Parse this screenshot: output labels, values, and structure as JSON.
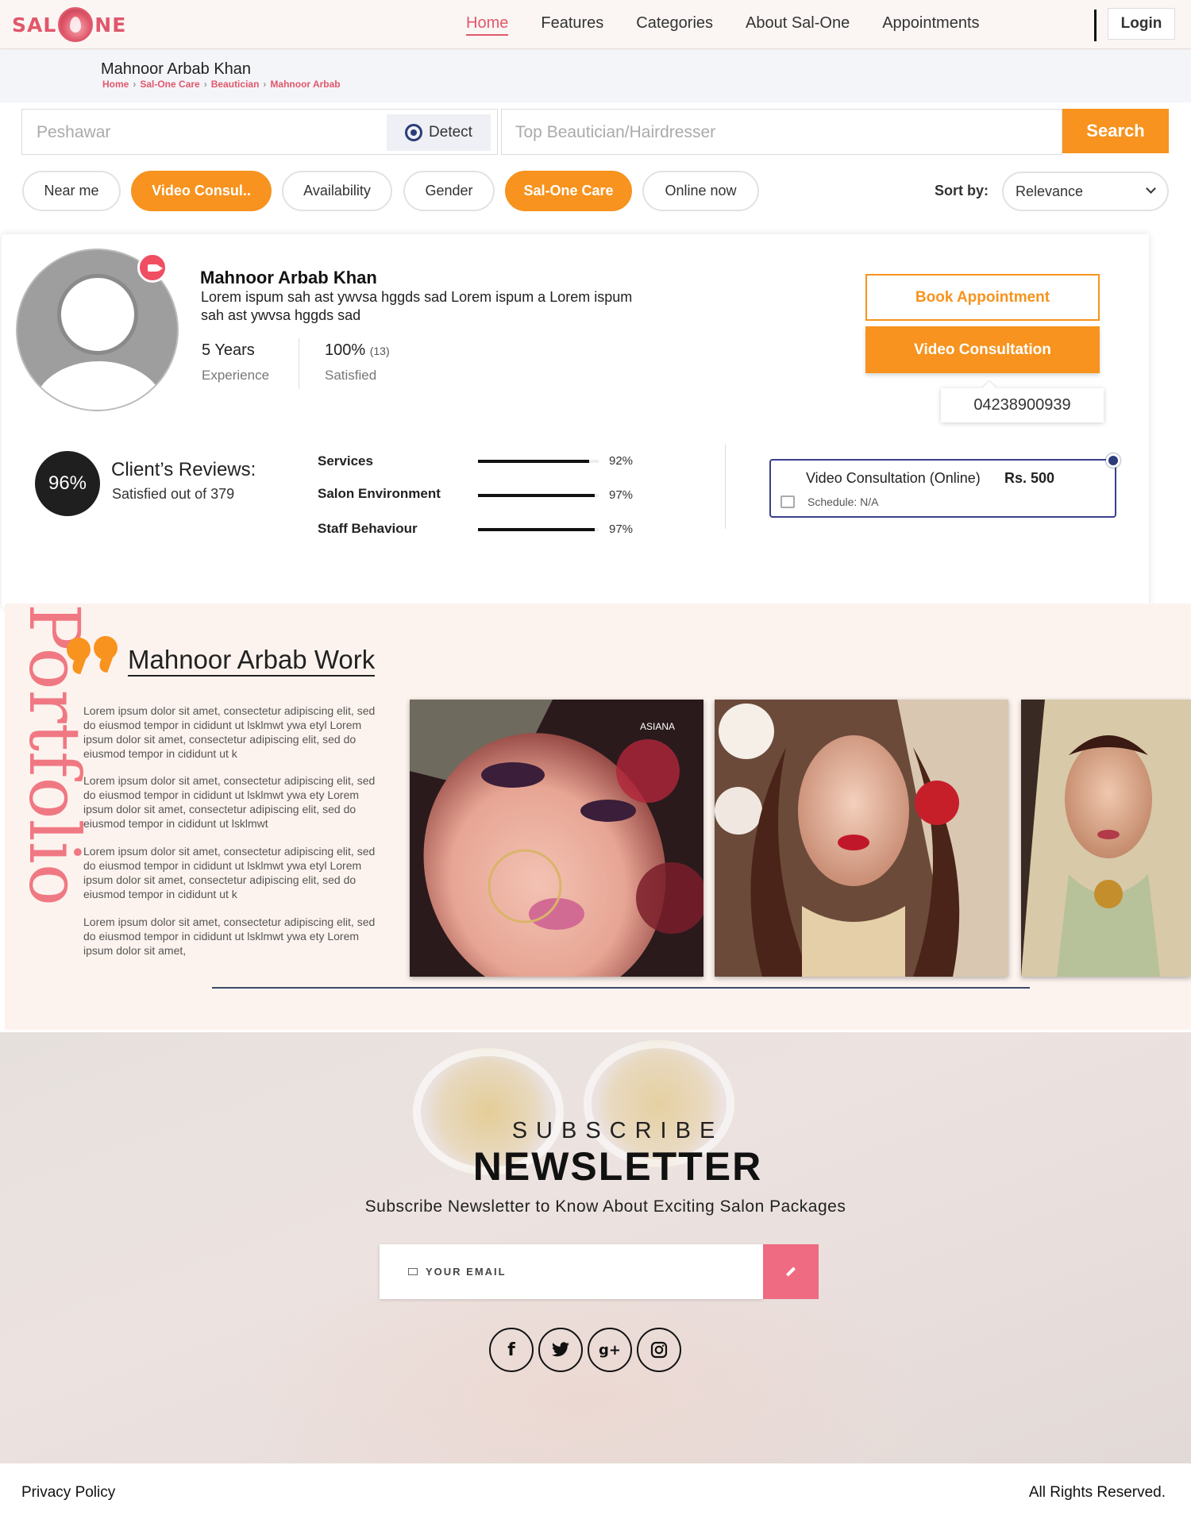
{
  "nav": {
    "logo_left": "SAL",
    "logo_right": "NE",
    "links": [
      "Home",
      "Features",
      "Categories",
      "About Sal-One",
      "Appointments"
    ],
    "login": "Login",
    "brand_color": "#e0586b"
  },
  "header": {
    "title": "Mahnoor Arbab Khan",
    "breadcrumb": [
      "Home",
      "Sal-One Care",
      "Beautician",
      "Mahnoor Arbab"
    ]
  },
  "search": {
    "location_placeholder": "Peshawar",
    "detect_label": "Detect",
    "service_placeholder": "Top Beautician/Hairdresser",
    "search_label": "Search"
  },
  "filters": {
    "chips": [
      {
        "label": "Near me",
        "active": false
      },
      {
        "label": "Video Consul..",
        "active": true
      },
      {
        "label": "Availability",
        "active": false
      },
      {
        "label": "Gender",
        "active": false
      },
      {
        "label": "Sal-One Care",
        "active": true
      },
      {
        "label": "Online now",
        "active": false
      }
    ],
    "sort_label": "Sort by:",
    "sort_value": "Relevance",
    "accent_color": "#f7931e"
  },
  "profile": {
    "name": "Mahnoor Arbab Khan",
    "description": "Lorem ispum sah ast ywvsa hggds sad Lorem ispum a Lorem ispum sah ast ywvsa hggds sad",
    "experience_value": "5 Years",
    "experience_label": "Experience",
    "satisfied_value": "100%",
    "satisfied_count": "(13)",
    "satisfied_label": "Satisfied",
    "book_label": "Book Appointment",
    "video_label": "Video Consultation",
    "phone": "04238900939"
  },
  "reviews": {
    "percent": "96%",
    "title": "Client’s Reviews:",
    "subtitle": "Satisfied out of 379",
    "bars": [
      {
        "label": "Services",
        "value": 92,
        "text": "92%"
      },
      {
        "label": "Salon Environment",
        "value": 97,
        "text": "97%"
      },
      {
        "label": "Staff Behaviour",
        "value": 97,
        "text": "97%"
      }
    ]
  },
  "consultation": {
    "title": "Video Consultation (Online)",
    "price": "Rs. 500",
    "schedule": "Schedule: N/A"
  },
  "portfolio": {
    "vertical_label": "Portfolio",
    "title": "Mahnoor Arbab Work",
    "paragraphs": [
      "Lorem ipsum dolor sit amet, consectetur adipiscing elit, sed do eiusmod tempor in cididunt ut lsklmwt ywa etyl Lorem ipsum dolor sit amet, consectetur adipiscing elit, sed do eiusmod tempor in cididunt ut k",
      "Lorem ipsum dolor sit amet, consectetur adipiscing elit, sed do eiusmod tempor in cididunt ut lsklmwt ywa ety Lorem ipsum dolor sit amet, consectetur adipiscing elit, sed do eiusmod tempor in cididunt ut lsklmwt",
      "Lorem ipsum dolor sit amet, consectetur adipiscing elit, sed do eiusmod tempor in cididunt ut lsklmwt ywa etyl Lorem ipsum dolor sit amet, consectetur adipiscing elit, sed do eiusmod tempor in cididunt ut k",
      "Lorem ipsum dolor sit amet, consectetur adipiscing elit, sed do eiusmod tempor in cididunt ut lsklmwt ywa ety Lorem ipsum dolor sit amet,"
    ],
    "photo_logo": "ASIANA"
  },
  "newsletter": {
    "subscribe": "SUBSCRIBE",
    "title": "NEWSLETTER",
    "description": "Subscribe Newsletter to Know About Exciting Salon Packages",
    "email_placeholder": "YOUR EMAIL",
    "socials": [
      "facebook-icon",
      "twitter-icon",
      "google-plus-icon",
      "instagram-icon"
    ],
    "button_color": "#ee6b82"
  },
  "footer": {
    "privacy": "Privacy Policy",
    "rights": "All Rights Reserved."
  }
}
